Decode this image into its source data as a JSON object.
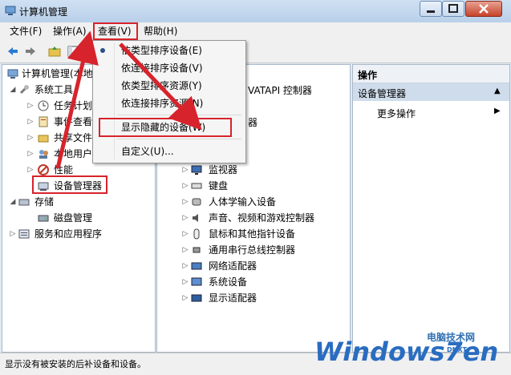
{
  "window": {
    "title": "计算机管理"
  },
  "menubar": {
    "items": [
      {
        "label": "文件(F)"
      },
      {
        "label": "操作(A)"
      },
      {
        "label": "查看(V)"
      },
      {
        "label": "帮助(H)"
      }
    ]
  },
  "view_menu": {
    "items": [
      {
        "label": "依类型排序设备(E)",
        "checked": true
      },
      {
        "label": "依连接排序设备(V)",
        "checked": false
      },
      {
        "label": "依类型排序资源(Y)",
        "checked": false
      },
      {
        "label": "依连接排序资源(N)",
        "checked": false
      },
      {
        "label": "显示隐藏的设备(W)",
        "checked": false
      },
      {
        "label": "自定义(U)...",
        "checked": false
      }
    ]
  },
  "left_tree": {
    "root": "计算机管理(本地",
    "system_tools": "系统工具",
    "children": [
      "任务计划",
      "事件查看",
      "共享文件",
      "本地用户",
      "性能",
      "设备管理器"
    ],
    "storage": "存储",
    "disk_mgmt": "磁盘管理",
    "services": "服务和应用程序"
  },
  "device_tree": {
    "partial_1": "VATAPI 控制器",
    "partial_2": "器",
    "items": [
      "监视器",
      "键盘",
      "人体学输入设备",
      "声音、视频和游戏控制器",
      "鼠标和其他指针设备",
      "通用串行总线控制器",
      "网络适配器",
      "系统设备",
      "显示适配器"
    ]
  },
  "actions": {
    "header": "操作",
    "section": "设备管理器",
    "more": "更多操作"
  },
  "status": {
    "text": "显示没有被安装的后补设备和设备。"
  },
  "watermark": {
    "site": "电脑技术网",
    "brand": "Windows7en",
    "tag": "DNXT"
  },
  "colors": {
    "annotation_red": "#d7232b",
    "selection_blue": "#cfdcec"
  }
}
